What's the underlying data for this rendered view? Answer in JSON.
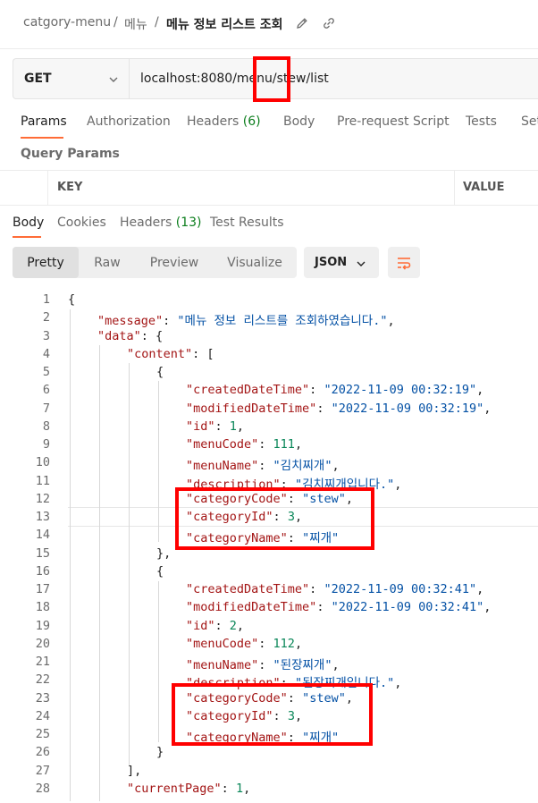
{
  "breadcrumb": {
    "collection": "catgory-menu",
    "folder": "메뉴",
    "separator": "/",
    "request": "메뉴 정보 리스트 조회",
    "icons": [
      "edit-icon",
      "link-icon"
    ]
  },
  "request": {
    "method": "GET",
    "url": "localhost:8080/menu/stew/list"
  },
  "request_tabs": [
    {
      "label": "Params",
      "active": true
    },
    {
      "label": "Authorization"
    },
    {
      "label": "Headers",
      "count": "(6)"
    },
    {
      "label": "Body"
    },
    {
      "label": "Pre-request Script"
    },
    {
      "label": "Tests"
    },
    {
      "label": "Set"
    }
  ],
  "query_params": {
    "title": "Query Params",
    "key_header": "KEY",
    "value_header": "VALUE"
  },
  "response_tabs": [
    {
      "label": "Body",
      "active": true
    },
    {
      "label": "Cookies"
    },
    {
      "label": "Headers",
      "count": "(13)"
    },
    {
      "label": "Test Results"
    }
  ],
  "view_modes": [
    "Pretty",
    "Raw",
    "Preview",
    "Visualize"
  ],
  "active_view": "Pretty",
  "format": "JSON",
  "accent_color": "#ff6c37",
  "highlight_color": "#ff0000",
  "code_lines": [
    {
      "n": "1",
      "tokens": [
        [
          "p",
          "{"
        ]
      ]
    },
    {
      "n": "2",
      "tokens": [
        [
          "k",
          "\"message\""
        ],
        [
          "p",
          ": "
        ],
        [
          "s",
          "\"메뉴 정보 리스트를 조회하였습니다.\""
        ],
        [
          "p",
          ","
        ]
      ]
    },
    {
      "n": "3",
      "tokens": [
        [
          "k",
          "\"data\""
        ],
        [
          "p",
          ": {"
        ]
      ]
    },
    {
      "n": "4",
      "tokens": [
        [
          "k",
          "\"content\""
        ],
        [
          "p",
          ": ["
        ]
      ]
    },
    {
      "n": "5",
      "tokens": [
        [
          "p",
          "{"
        ]
      ]
    },
    {
      "n": "6",
      "tokens": [
        [
          "k",
          "\"createdDateTime\""
        ],
        [
          "p",
          ": "
        ],
        [
          "s",
          "\"2022-11-09 00:32:19\""
        ],
        [
          "p",
          ","
        ]
      ]
    },
    {
      "n": "7",
      "tokens": [
        [
          "k",
          "\"modifiedDateTime\""
        ],
        [
          "p",
          ": "
        ],
        [
          "s",
          "\"2022-11-09 00:32:19\""
        ],
        [
          "p",
          ","
        ]
      ]
    },
    {
      "n": "8",
      "tokens": [
        [
          "k",
          "\"id\""
        ],
        [
          "p",
          ": "
        ],
        [
          "n",
          "1"
        ],
        [
          "p",
          ","
        ]
      ]
    },
    {
      "n": "9",
      "tokens": [
        [
          "k",
          "\"menuCode\""
        ],
        [
          "p",
          ": "
        ],
        [
          "n",
          "111"
        ],
        [
          "p",
          ","
        ]
      ]
    },
    {
      "n": "10",
      "tokens": [
        [
          "k",
          "\"menuName\""
        ],
        [
          "p",
          ": "
        ],
        [
          "s",
          "\"김치찌개\""
        ],
        [
          "p",
          ","
        ]
      ]
    },
    {
      "n": "11",
      "tokens": [
        [
          "k",
          "\"description\""
        ],
        [
          "p",
          ": "
        ],
        [
          "s",
          "\"김치찌개입니다.\""
        ],
        [
          "p",
          ","
        ]
      ]
    },
    {
      "n": "12",
      "tokens": [
        [
          "k",
          "\"categoryCode\""
        ],
        [
          "p",
          ": "
        ],
        [
          "s",
          "\"stew\""
        ],
        [
          "p",
          ","
        ]
      ]
    },
    {
      "n": "13",
      "tokens": [
        [
          "k",
          "\"categoryId\""
        ],
        [
          "p",
          ": "
        ],
        [
          "n",
          "3"
        ],
        [
          "p",
          ","
        ]
      ]
    },
    {
      "n": "14",
      "tokens": [
        [
          "k",
          "\"categoryName\""
        ],
        [
          "p",
          ": "
        ],
        [
          "s",
          "\"찌개\""
        ]
      ]
    },
    {
      "n": "15",
      "tokens": [
        [
          "p",
          "},"
        ]
      ]
    },
    {
      "n": "16",
      "tokens": [
        [
          "p",
          "{"
        ]
      ]
    },
    {
      "n": "17",
      "tokens": [
        [
          "k",
          "\"createdDateTime\""
        ],
        [
          "p",
          ": "
        ],
        [
          "s",
          "\"2022-11-09 00:32:41\""
        ],
        [
          "p",
          ","
        ]
      ]
    },
    {
      "n": "18",
      "tokens": [
        [
          "k",
          "\"modifiedDateTime\""
        ],
        [
          "p",
          ": "
        ],
        [
          "s",
          "\"2022-11-09 00:32:41\""
        ],
        [
          "p",
          ","
        ]
      ]
    },
    {
      "n": "19",
      "tokens": [
        [
          "k",
          "\"id\""
        ],
        [
          "p",
          ": "
        ],
        [
          "n",
          "2"
        ],
        [
          "p",
          ","
        ]
      ]
    },
    {
      "n": "20",
      "tokens": [
        [
          "k",
          "\"menuCode\""
        ],
        [
          "p",
          ": "
        ],
        [
          "n",
          "112"
        ],
        [
          "p",
          ","
        ]
      ]
    },
    {
      "n": "21",
      "tokens": [
        [
          "k",
          "\"menuName\""
        ],
        [
          "p",
          ": "
        ],
        [
          "s",
          "\"된장찌개\""
        ],
        [
          "p",
          ","
        ]
      ]
    },
    {
      "n": "22",
      "tokens": [
        [
          "k",
          "\"description\""
        ],
        [
          "p",
          ": "
        ],
        [
          "s",
          "\"된장찌개입니다.\""
        ],
        [
          "p",
          ","
        ]
      ]
    },
    {
      "n": "23",
      "tokens": [
        [
          "k",
          "\"categoryCode\""
        ],
        [
          "p",
          ": "
        ],
        [
          "s",
          "\"stew\""
        ],
        [
          "p",
          ","
        ]
      ]
    },
    {
      "n": "24",
      "tokens": [
        [
          "k",
          "\"categoryId\""
        ],
        [
          "p",
          ": "
        ],
        [
          "n",
          "3"
        ],
        [
          "p",
          ","
        ]
      ]
    },
    {
      "n": "25",
      "tokens": [
        [
          "k",
          "\"categoryName\""
        ],
        [
          "p",
          ": "
        ],
        [
          "s",
          "\"찌개\""
        ]
      ]
    },
    {
      "n": "26",
      "tokens": [
        [
          "p",
          "}"
        ]
      ]
    },
    {
      "n": "27",
      "tokens": [
        [
          "p",
          "],"
        ]
      ]
    },
    {
      "n": "28",
      "tokens": [
        [
          "k",
          "\"currentPage\""
        ],
        [
          "p",
          ": "
        ],
        [
          "n",
          "1"
        ],
        [
          "p",
          ","
        ]
      ]
    }
  ]
}
